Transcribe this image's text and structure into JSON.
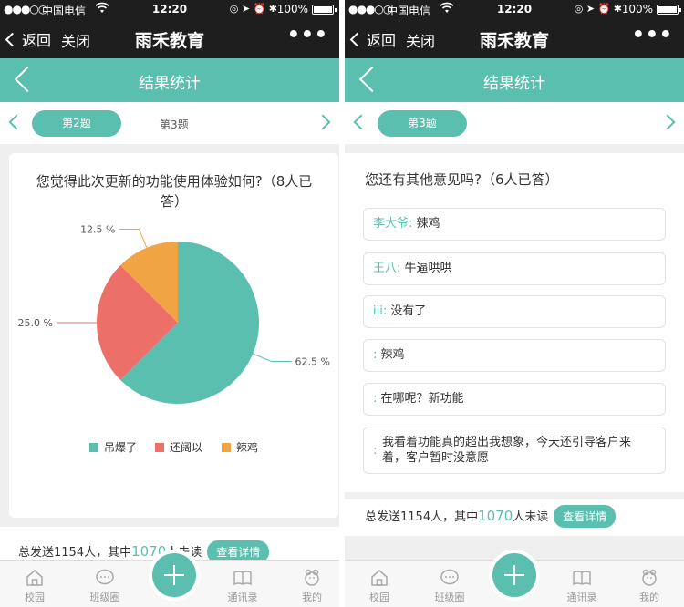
{
  "status_bar": {
    "signal": "●●●○○",
    "carrier": "中国电信",
    "time": "12:20",
    "battery": "100%"
  },
  "wechat_bar": {
    "back_label": "返回",
    "close_label": "关闭",
    "title": "雨禾教育",
    "more_label": "•••"
  },
  "page_header": {
    "title": "结果统计"
  },
  "left_screen": {
    "question_nav": {
      "active": "第2题",
      "next": "第3题"
    },
    "question": "您觉得此次更新的功能使用体验如何?（8人已答）",
    "question_line1": "您觉得此次更新的功能使用体验如何?（8人已",
    "question_line2": "答）",
    "footer": {
      "prefix": "总发送1154人，其中",
      "count": "1070",
      "suffix": "人未读",
      "button": "查看详情"
    }
  },
  "right_screen": {
    "question_nav": {
      "active": "第3题"
    },
    "question": "您还有其他意见吗?（6人已答）",
    "answers": [
      {
        "name": "李大爷:",
        "text": "辣鸡"
      },
      {
        "name": "王八:",
        "text": "牛逼哄哄"
      },
      {
        "name": "iii:",
        "text": "没有了"
      },
      {
        "name": ":",
        "text": "辣鸡"
      },
      {
        "name": ":",
        "text": "在哪呢？新功能"
      },
      {
        "name": ":",
        "text": "我看着功能真的超出我想象，今天还引导客户来着，客户暂时没意愿",
        "line1": "我看着功能真的超出我想象，今天还引导客户来",
        "line2": "着，客户暂时没意愿"
      }
    ],
    "footer": {
      "prefix": "总发送1154人，其中",
      "count": "1070",
      "suffix": "人未读",
      "button": "查看详情"
    }
  },
  "tab_bar": {
    "items": [
      {
        "label": "校园",
        "icon": "school-icon"
      },
      {
        "label": "班级圈",
        "icon": "chat-bubble-icon"
      },
      {
        "label": "",
        "icon": "plus-icon"
      },
      {
        "label": "通讯录",
        "icon": "book-icon"
      },
      {
        "label": "我的",
        "icon": "profile-icon"
      }
    ]
  },
  "colors": {
    "accent": "#5bbfaf",
    "slice1": "#5bbfaf",
    "slice2": "#ec6f6a",
    "slice3": "#f0a443"
  },
  "chart_data": {
    "type": "pie",
    "title": "您觉得此次更新的功能使用体验如何?（8人已答）",
    "categories": [
      "吊爆了",
      "还阔以",
      "辣鸡"
    ],
    "values": [
      62.5,
      25.0,
      12.5
    ],
    "value_labels": [
      "62.5 %",
      "25.0 %",
      "12.5 %"
    ],
    "colors": [
      "#5bbfaf",
      "#ec6f6a",
      "#f0a443"
    ],
    "legend_position": "bottom"
  }
}
